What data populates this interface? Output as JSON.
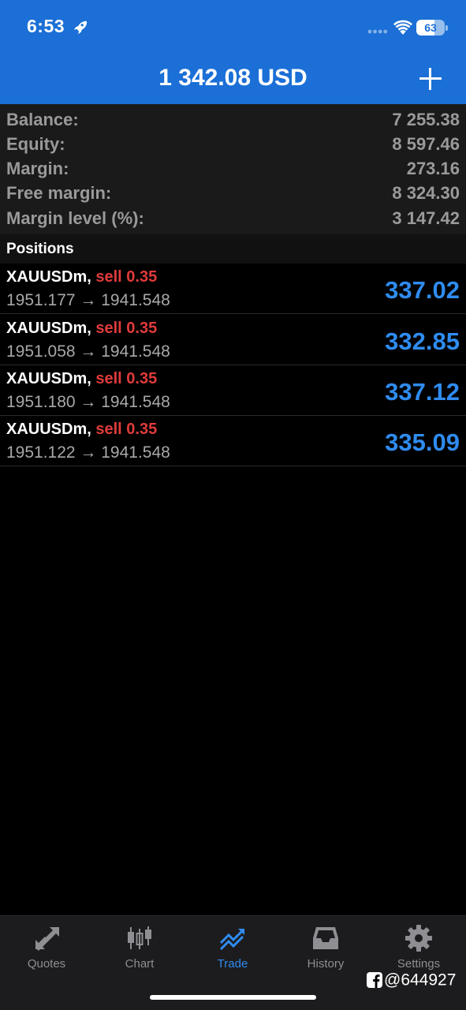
{
  "status_bar": {
    "time": "6:53",
    "battery_level": "63",
    "battery_fraction": 0.63
  },
  "header": {
    "title": "1 342.08 USD",
    "add_icon": "plus-icon"
  },
  "summary": [
    {
      "label": "Balance:",
      "value": "7 255.38"
    },
    {
      "label": "Equity:",
      "value": "8 597.46"
    },
    {
      "label": "Margin:",
      "value": "273.16"
    },
    {
      "label": "Free margin:",
      "value": "8 324.30"
    },
    {
      "label": "Margin level (%):",
      "value": "3 147.42"
    }
  ],
  "positions": {
    "title": "Positions",
    "items": [
      {
        "symbol": "XAUUSDm,",
        "type": "sell 0.35",
        "prices": "1951.177 → 1941.548",
        "profit": "337.02"
      },
      {
        "symbol": "XAUUSDm,",
        "type": "sell 0.35",
        "prices": "1951.058 → 1941.548",
        "profit": "332.85"
      },
      {
        "symbol": "XAUUSDm,",
        "type": "sell 0.35",
        "prices": "1951.180 → 1941.548",
        "profit": "337.12"
      },
      {
        "symbol": "XAUUSDm,",
        "type": "sell 0.35",
        "prices": "1951.122 → 1941.548",
        "profit": "335.09"
      }
    ]
  },
  "tabs": [
    {
      "label": "Quotes",
      "icon": "quotes-arrows-icon",
      "active": false
    },
    {
      "label": "Chart",
      "icon": "candlestick-chart-icon",
      "active": false
    },
    {
      "label": "Trade",
      "icon": "trade-trend-icon",
      "active": true
    },
    {
      "label": "History",
      "icon": "history-tray-icon",
      "active": false
    },
    {
      "label": "Settings",
      "icon": "gear-icon",
      "active": false
    }
  ],
  "watermark": {
    "text": "@644927",
    "icon": "facebook-icon"
  },
  "colors": {
    "header_blue": "#1b6fd6",
    "profit_blue": "#2f8cf0",
    "sell_red": "#e03b3b",
    "muted_gray": "#9a9a9a"
  }
}
